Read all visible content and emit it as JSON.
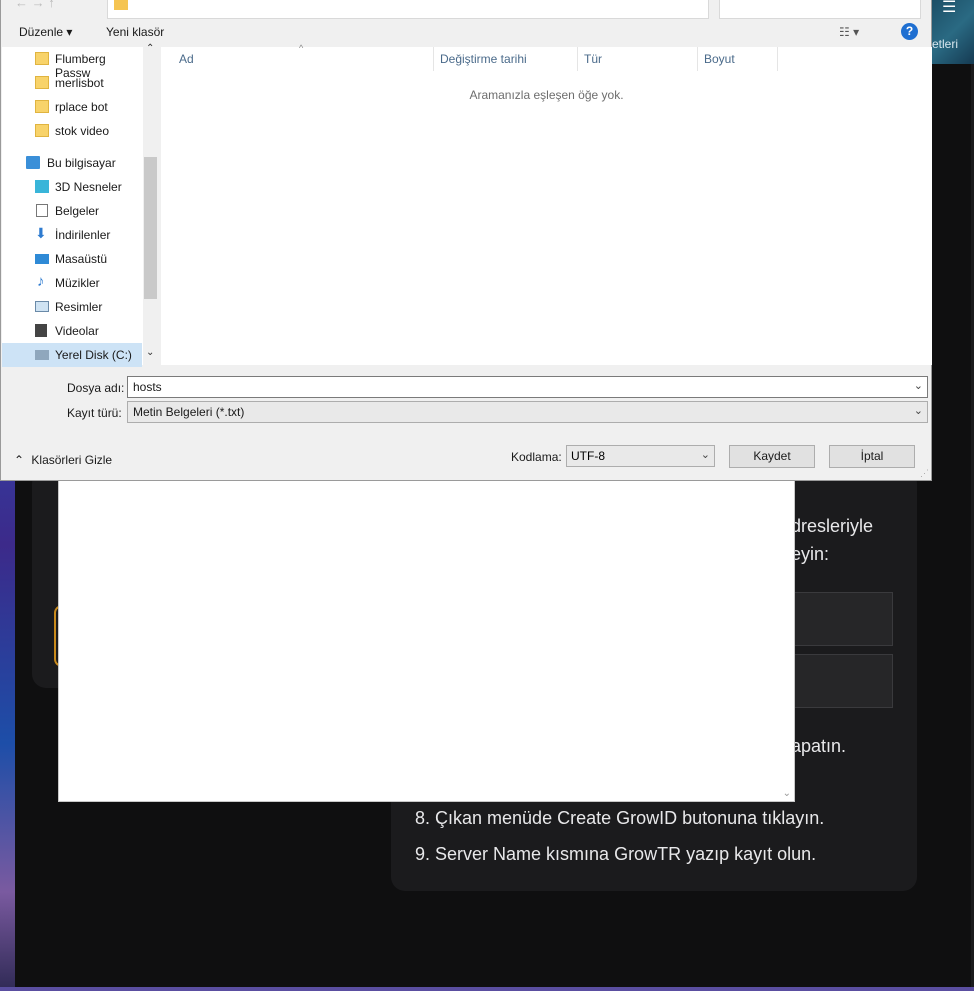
{
  "background_page": {
    "tab_label": "etleri",
    "steps": [
      {
        "text": "dresleriyle"
      },
      {
        "text": "eyin:"
      },
      {
        "text": "apatın."
      },
      {
        "text": "8. Çıkan menüde Create GrowID butonuna tıklayın."
      },
      {
        "text": "9. Server Name kısmına GrowTR yazıp kayıt olun."
      }
    ]
  },
  "dialog": {
    "toolbar": {
      "organize": "Düzenle ▾",
      "new_folder": "Yeni klasör",
      "help": "?"
    },
    "nav_items": [
      {
        "label": "Flumberg Passw",
        "icon": "folder-icon"
      },
      {
        "label": "merlisbot",
        "icon": "folder-icon"
      },
      {
        "label": "rplace bot",
        "icon": "folder-icon"
      },
      {
        "label": "stok video",
        "icon": "folder-icon"
      },
      {
        "label": "Bu bilgisayar",
        "icon": "computer-icon"
      },
      {
        "label": "3D Nesneler",
        "icon": "cube-icon"
      },
      {
        "label": "Belgeler",
        "icon": "document-icon"
      },
      {
        "label": "İndirilenler",
        "icon": "download-icon"
      },
      {
        "label": "Masaüstü",
        "icon": "desktop-icon"
      },
      {
        "label": "Müzikler",
        "icon": "music-icon"
      },
      {
        "label": "Resimler",
        "icon": "picture-icon"
      },
      {
        "label": "Videolar",
        "icon": "video-icon"
      },
      {
        "label": "Yerel Disk (C:)",
        "icon": "drive-icon",
        "selected": true
      }
    ],
    "columns": [
      "Ad",
      "Değiştirme tarihi",
      "Tür",
      "Boyut"
    ],
    "empty_message": "Aramanızla eşleşen öğe yok.",
    "filename_label": "Dosya adı:",
    "filename_value": "hosts",
    "filetype_label": "Kayıt türü:",
    "filetype_value": "Metin Belgeleri (*.txt)",
    "hide_folders": "Klasörleri Gizle",
    "encoding_label": "Kodlama:",
    "encoding_value": "UTF-8",
    "save_button": "Kaydet",
    "cancel_button": "İptal"
  }
}
